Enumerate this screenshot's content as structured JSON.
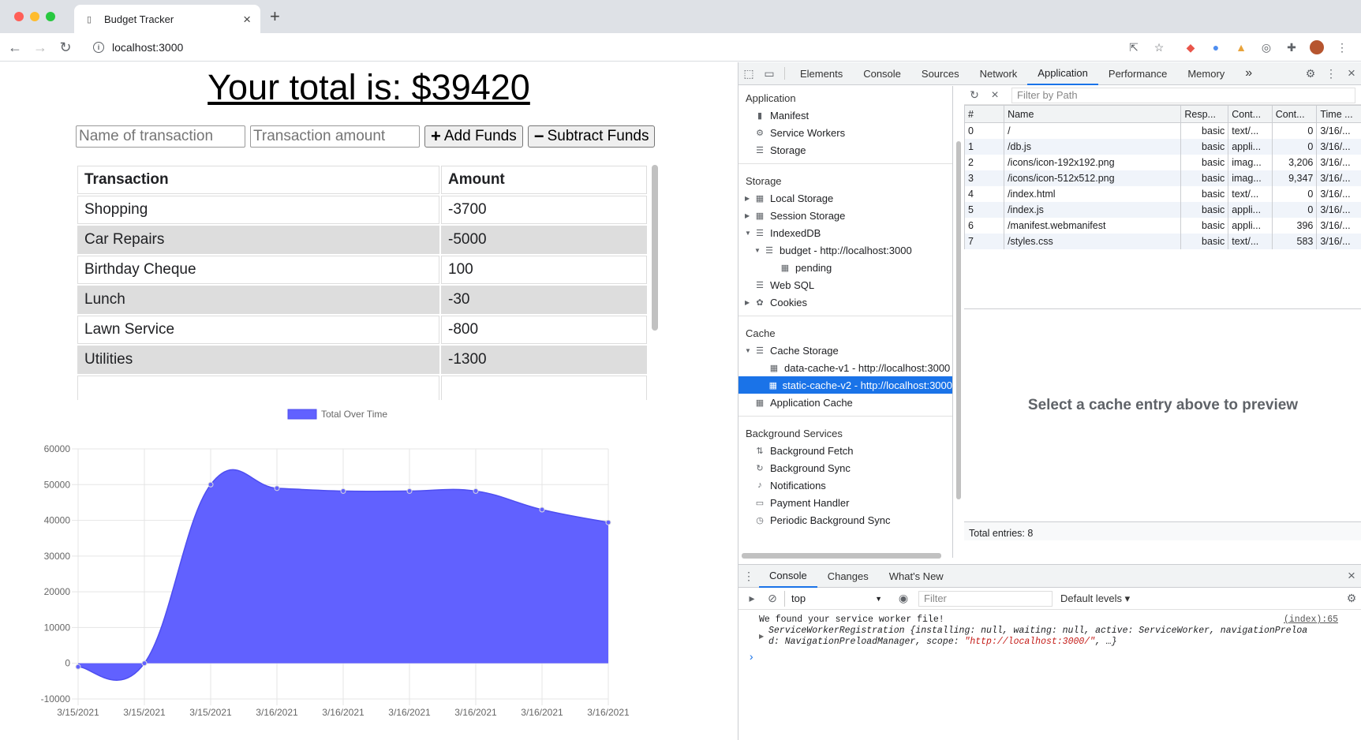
{
  "browser": {
    "tab_title": "Budget Tracker",
    "new_tab": "+",
    "url": "localhost:3000"
  },
  "app": {
    "total_text": "Your total is: $39420",
    "name_placeholder": "Name of transaction",
    "amount_placeholder": "Transaction amount",
    "add_label": "Add Funds",
    "subtract_label": "Subtract Funds",
    "table_headers": [
      "Transaction",
      "Amount"
    ],
    "rows": [
      {
        "name": "Shopping",
        "amount": "-3700"
      },
      {
        "name": "Car Repairs",
        "amount": "-5000"
      },
      {
        "name": "Birthday Cheque",
        "amount": "100"
      },
      {
        "name": "Lunch",
        "amount": "-30"
      },
      {
        "name": "Lawn Service",
        "amount": "-800"
      },
      {
        "name": "Utilities",
        "amount": "-1300"
      }
    ]
  },
  "chart_data": {
    "type": "area",
    "legend": "Total Over Time",
    "legend_position": "top",
    "color": "#6161ff",
    "x": [
      "3/15/2021",
      "3/15/2021",
      "3/15/2021",
      "3/16/2021",
      "3/16/2021",
      "3/16/2021",
      "3/16/2021",
      "3/16/2021",
      "3/16/2021"
    ],
    "values": [
      -1000,
      0,
      50000,
      49000,
      48200,
      48200,
      48200,
      43000,
      39420
    ],
    "y_ticks": [
      60000,
      50000,
      40000,
      30000,
      20000,
      10000,
      0,
      -10000
    ],
    "ylim": [
      -10000,
      60000
    ],
    "grid": true
  },
  "devtools": {
    "tabs": [
      "Elements",
      "Console",
      "Sources",
      "Network",
      "Application",
      "Performance",
      "Memory"
    ],
    "active_tab": "Application",
    "more": "»",
    "sidebar": {
      "application_title": "Application",
      "application_items": [
        {
          "label": "Manifest",
          "icon": "file-icon"
        },
        {
          "label": "Service Workers",
          "icon": "gear-icon"
        },
        {
          "label": "Storage",
          "icon": "database-icon"
        }
      ],
      "storage_title": "Storage",
      "local_storage": "Local Storage",
      "session_storage": "Session Storage",
      "indexeddb": "IndexedDB",
      "budget_db": "budget - http://localhost:3000",
      "pending": "pending",
      "web_sql": "Web SQL",
      "cookies": "Cookies",
      "cache_title": "Cache",
      "cache_storage": "Cache Storage",
      "data_cache": "data-cache-v1 - http://localhost:3000",
      "static_cache": "static-cache-v2 - http://localhost:3000",
      "app_cache": "Application Cache",
      "bg_title": "Background Services",
      "bg_items": [
        "Background Fetch",
        "Background Sync",
        "Notifications",
        "Payment Handler",
        "Periodic Background Sync"
      ]
    },
    "filter_placeholder": "Filter by Path",
    "cache_headers": [
      "#",
      "Name",
      "Resp...",
      "Cont...",
      "Cont...",
      "Time ..."
    ],
    "cache_rows": [
      [
        "0",
        "/",
        "basic",
        "text/...",
        "0",
        "3/16/..."
      ],
      [
        "1",
        "/db.js",
        "basic",
        "appli...",
        "0",
        "3/16/..."
      ],
      [
        "2",
        "/icons/icon-192x192.png",
        "basic",
        "imag...",
        "3,206",
        "3/16/..."
      ],
      [
        "3",
        "/icons/icon-512x512.png",
        "basic",
        "imag...",
        "9,347",
        "3/16/..."
      ],
      [
        "4",
        "/index.html",
        "basic",
        "text/...",
        "0",
        "3/16/..."
      ],
      [
        "5",
        "/index.js",
        "basic",
        "appli...",
        "0",
        "3/16/..."
      ],
      [
        "6",
        "/manifest.webmanifest",
        "basic",
        "appli...",
        "396",
        "3/16/..."
      ],
      [
        "7",
        "/styles.css",
        "basic",
        "text/...",
        "583",
        "3/16/..."
      ]
    ],
    "preview_text": "Select a cache entry above to preview",
    "total_entries": "Total entries: 8",
    "drawer_tabs": [
      "Console",
      "Changes",
      "What's New"
    ],
    "context": "top",
    "console_filter": "Filter",
    "levels": "Default levels ▾",
    "console_line1": "We found your service worker file!",
    "console_source": "(index):65",
    "console_line2a": "ServiceWorkerRegistration {installing: null, waiting: null, active: ServiceWorker, navigationPreloa",
    "console_line2b_prefix": "d: NavigationPreloadManager, scope: ",
    "console_scope": "\"http://localhost:3000/\"",
    "console_line2b_suffix": ", …}",
    "prompt": "›"
  }
}
